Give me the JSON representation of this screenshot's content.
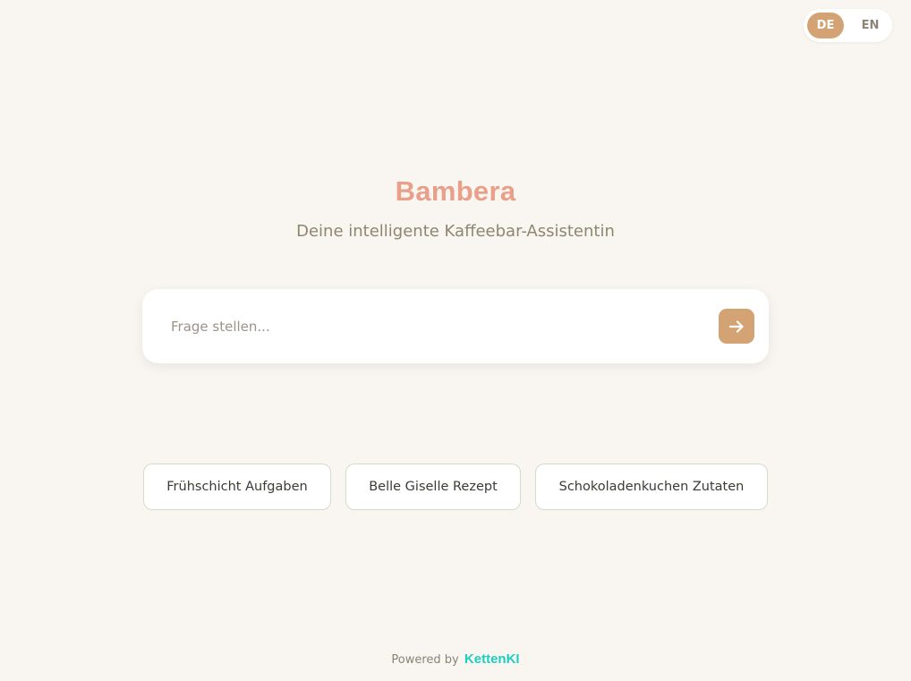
{
  "lang_toggle": {
    "options": [
      "DE",
      "EN"
    ],
    "active": "DE"
  },
  "header": {
    "title": "Bambera",
    "subtitle": "Deine intelligente Kaffeebar-Assistentin"
  },
  "search": {
    "placeholder": "Frage stellen...",
    "value": "",
    "send_icon": "arrow-right-icon"
  },
  "suggestions": [
    {
      "label": "Frühschicht Aufgaben"
    },
    {
      "label": "Belle Giselle Rezept"
    },
    {
      "label": "Schokoladenkuchen Zutaten"
    }
  ],
  "footer": {
    "powered_by": "Powered by",
    "brand": "KettenKI"
  },
  "colors": {
    "background": "#f9f6f1",
    "accent": "#d4a373",
    "title": "#e8a08a",
    "brand": "#1ccfc0"
  }
}
